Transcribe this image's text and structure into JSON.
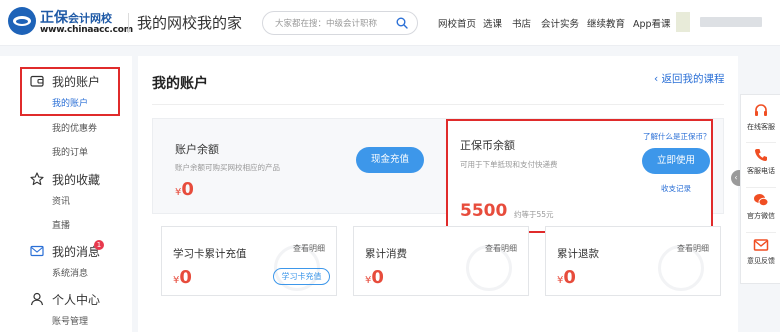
{
  "header": {
    "logo_cn": "正保",
    "logo_cn_small": "会计网校",
    "logo_url": "www.chinaacc.com",
    "slogan": "我的网校我的家",
    "search_placeholder": "大家都在搜：中级会计职称",
    "nav": [
      "网校首页",
      "选课",
      "书店",
      "会计实务",
      "继续教育",
      "App看课"
    ]
  },
  "sidebar": {
    "groups": [
      {
        "title": "我的账户",
        "icon": "wallet-icon",
        "items": [
          "我的账户",
          "我的优惠券",
          "我的订单"
        ]
      },
      {
        "title": "我的收藏",
        "icon": "star-icon",
        "items": [
          "资讯",
          "直播"
        ]
      },
      {
        "title": "我的消息",
        "icon": "mail-icon",
        "badge": "1",
        "items": [
          "系统消息"
        ]
      },
      {
        "title": "个人中心",
        "icon": "person-icon",
        "items": [
          "账号管理"
        ]
      }
    ],
    "active_item": "我的账户"
  },
  "main": {
    "title": "我的账户",
    "back_link": "返回我的课程",
    "balance": {
      "title": "账户余额",
      "desc": "账户余额可购买网校相应的产品",
      "currency": "¥",
      "amount": "0",
      "button": "现金充值"
    },
    "coin": {
      "title": "正保币余额",
      "learn_more": "了解什么是正保币？",
      "desc": "可用于下单抵现和支付快递费",
      "amount": "5500",
      "approx": "约等于55元",
      "button": "立即使用",
      "records": "收支记录"
    },
    "cards": [
      {
        "title": "学习卡累计充值",
        "detail": "查看明细",
        "currency": "¥",
        "amount": "0",
        "button": "学习卡充值"
      },
      {
        "title": "累计消费",
        "detail": "查看明细",
        "currency": "¥",
        "amount": "0"
      },
      {
        "title": "累计退款",
        "detail": "查看明细",
        "currency": "¥",
        "amount": "0"
      }
    ]
  },
  "float_bar": {
    "items": [
      "在线客服",
      "客服电话",
      "官方微信",
      "意见反馈"
    ]
  },
  "colors": {
    "accent": "#3d97ea",
    "link": "#2a6fd6",
    "money": "#e74c3c",
    "highlight_box": "#e02b2b",
    "float_icon": "#f04e23"
  }
}
